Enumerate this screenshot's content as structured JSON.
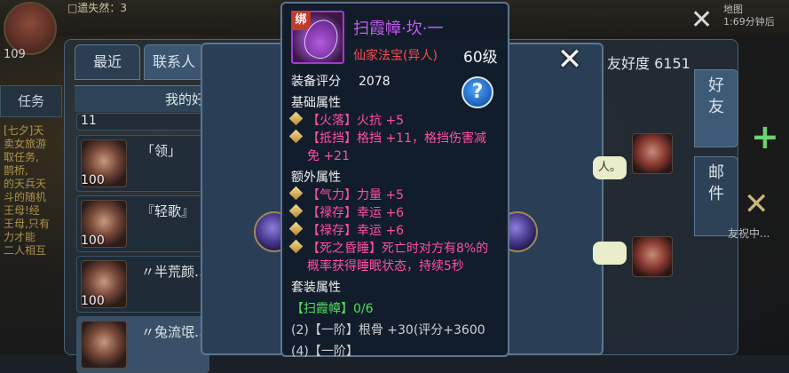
{
  "background": {
    "top_name": "□遗失然：3",
    "avatar_level": "109",
    "top_right_text": [
      "地图",
      "1:69分钟后"
    ],
    "quest_tab": "任务",
    "quest_text": [
      "[七夕]天",
      "卖女旅游",
      "取任务,",
      "鹊桥,",
      "的天兵天",
      "斗的随机",
      "王母!经",
      "王母,只有",
      "力才能",
      "二人相互"
    ],
    "bottom_right_text": "友祝中..."
  },
  "friend_panel": {
    "tabs": [
      "最近",
      "联系人"
    ],
    "header": "我的好",
    "goodwill": "友好度 6151",
    "side_tabs": [
      "好友",
      "邮件"
    ],
    "rows": [
      {
        "level": "11",
        "name": ""
      },
      {
        "level": "100",
        "name": "「领」"
      },
      {
        "level": "100",
        "name": "『轻歌』"
      },
      {
        "level": "100",
        "name": "〃半荒颜…"
      },
      {
        "level": "",
        "name": "〃兔流氓…"
      }
    ],
    "chat_bubbles": [
      "人。",
      ""
    ]
  },
  "tooltip": {
    "bind_badge": "绑",
    "item_name": "扫霞幛·坎·一",
    "item_type": "仙家法宝(异人)",
    "item_level": "60级",
    "score_label": "装备评分",
    "score_value": "2078",
    "help_icon": "question-mark-icon",
    "basic_title": "基础属性",
    "basic_attrs": [
      "【火落】火抗 +5",
      "【抵挡】格挡 +11，格挡伤害减",
      "免 +21"
    ],
    "extra_title": "额外属性",
    "extra_attrs": [
      "【气力】力量 +5",
      "【禄存】幸运 +6",
      "【禄存】幸运 +6",
      "【死之昏睡】死亡时对方有8%的",
      "概率获得睡眠状态，持续5秒"
    ],
    "set_title": "套装属性",
    "set_name": "【扫霞幛】0/6",
    "set_bonus": "(2)【一阶】根骨 +30(评分+3600",
    "set_bonus_next": "(4)【一阶】"
  },
  "colors": {
    "item_name": "#c35cf0",
    "item_type": "#ff4a4a",
    "attribute": "#ff4fa6",
    "set_name": "#52e05a"
  }
}
